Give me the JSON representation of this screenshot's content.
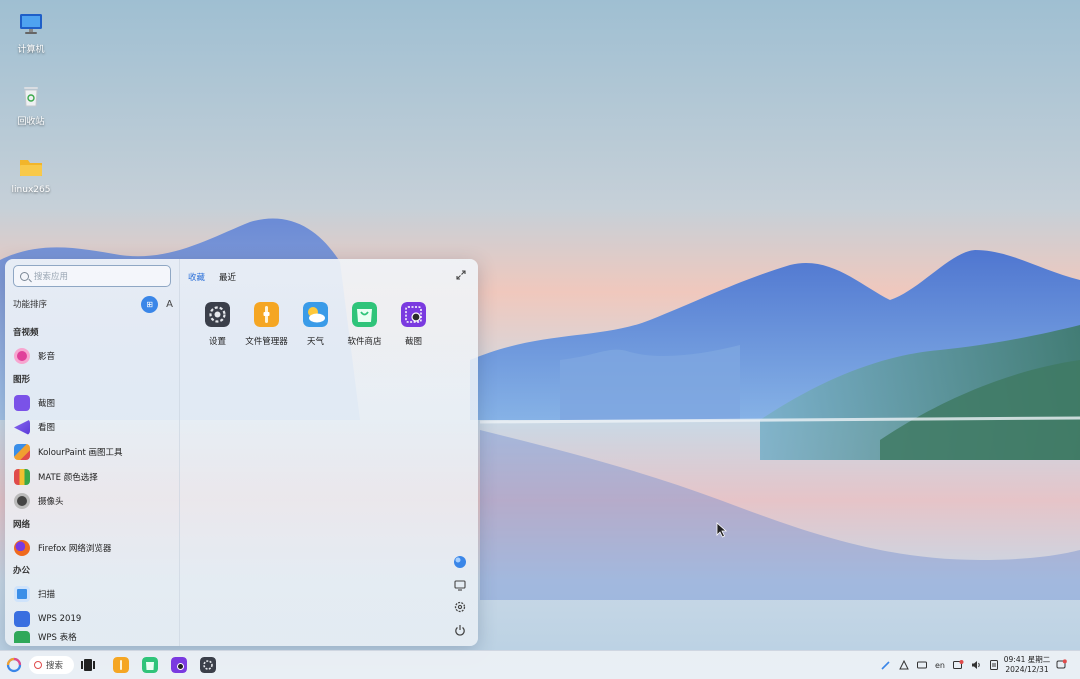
{
  "desktop": {
    "icons": [
      {
        "label": "计算机",
        "icon": "computer-icon"
      },
      {
        "label": "回收站",
        "icon": "trash-icon"
      },
      {
        "label": "linux265",
        "icon": "folder-icon"
      }
    ]
  },
  "start_menu": {
    "search_placeholder": "搜索应用",
    "sort_label": "功能排序",
    "sort_category_glyph": "⊞",
    "sort_alpha_glyph": "A",
    "categories": [
      {
        "title": "音视频",
        "apps": [
          {
            "label": "影音",
            "icon": "video-player-icon",
            "color": "#e0409a"
          }
        ]
      },
      {
        "title": "图形",
        "apps": [
          {
            "label": "截图",
            "icon": "screenshot-icon",
            "color": "#7a52e8"
          },
          {
            "label": "看图",
            "icon": "image-viewer-icon",
            "color": "#6a48e0"
          },
          {
            "label": "KolourPaint 画图工具",
            "icon": "paint-icon",
            "color": "#f0a030"
          },
          {
            "label": "MATE 颜色选择",
            "icon": "color-picker-icon",
            "color": "#3aa84a"
          },
          {
            "label": "摄像头",
            "icon": "camera-icon",
            "color": "#444444"
          }
        ]
      },
      {
        "title": "网络",
        "apps": [
          {
            "label": "Firefox 网络浏览器",
            "icon": "firefox-icon",
            "color": "#f06a1e"
          }
        ]
      },
      {
        "title": "办公",
        "apps": [
          {
            "label": "扫描",
            "icon": "scanner-icon",
            "color": "#3a8ee8"
          },
          {
            "label": "WPS 2019",
            "icon": "wps-icon",
            "color": "#3a6fe0"
          },
          {
            "label": "WPS 表格",
            "icon": "wps-spreadsheet-icon",
            "color": "#2fa85a"
          }
        ]
      }
    ],
    "tabs": {
      "favorites": "收藏",
      "recent": "最近"
    },
    "favorites": [
      {
        "label": "设置",
        "icon": "settings-icon",
        "color": "#3b3f4a"
      },
      {
        "label": "文件管理器",
        "icon": "file-manager-icon",
        "color": "#f5a623"
      },
      {
        "label": "天气",
        "icon": "weather-icon",
        "color": "#3a9be8"
      },
      {
        "label": "软件商店",
        "icon": "software-store-icon",
        "color": "#2fc47a"
      },
      {
        "label": "截图",
        "icon": "screenshot-icon",
        "color": "#7a3ae0"
      }
    ]
  },
  "taskbar": {
    "search_label": "搜索",
    "apps": [
      "multitask-view-icon",
      "file-manager-icon",
      "software-store-icon",
      "screenshot-icon",
      "settings-icon"
    ],
    "tray_input": "en",
    "clock_time": "09:41 星期二",
    "clock_date": "2024/12/31"
  }
}
